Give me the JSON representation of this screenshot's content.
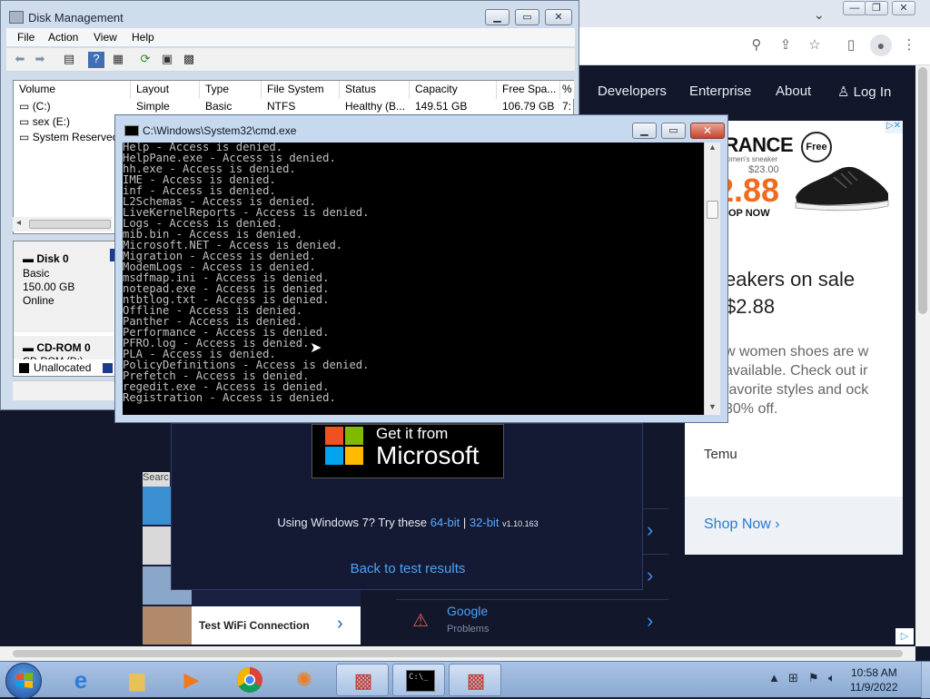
{
  "browser": {
    "nav": [
      "Developers",
      "Enterprise",
      "About",
      "Log In"
    ],
    "ad": {
      "clearance": "ARANCE",
      "sub": "omen's sneaker",
      "old_price": "$23.00",
      "price": "2.88",
      "shop": "HOP NOW",
      "free": "Free",
      "headline": "eakers on sale",
      "price_line": "$2.88",
      "desc": "w women shoes are w available. Check out ir favorite styles and ock 30% off.",
      "brand": "Temu",
      "cta": "Shop Now"
    },
    "promo": {
      "get_it": "Get it from",
      "microsoft": "Microsoft",
      "win7_prefix": "Using Windows 7? Try these",
      "link64": "64-bit",
      "sep": "|",
      "link32": "32-bit",
      "version": "v1.10.163",
      "back": "Back to test results"
    },
    "left_list": {
      "search": "Searc",
      "wifi": "Test WiFi Connection"
    },
    "right_list": {
      "google_title": "Google",
      "google_sub": "Problems"
    }
  },
  "disk_mgmt": {
    "title": "Disk Management",
    "menu": [
      "File",
      "Action",
      "View",
      "Help"
    ],
    "columns": [
      "Volume",
      "Layout",
      "Type",
      "File System",
      "Status",
      "Capacity",
      "Free Spa...",
      "%"
    ],
    "rows": [
      {
        "volume": "(C:)",
        "layout": "Simple",
        "type": "Basic",
        "fs": "NTFS",
        "status": "Healthy (B...",
        "capacity": "149.51 GB",
        "free": "106.79 GB",
        "pct": "7:"
      },
      {
        "volume": "sex (E:)"
      },
      {
        "volume": "System Reserved"
      }
    ],
    "disk0": {
      "name": "Disk 0",
      "type": "Basic",
      "size": "150.00 GB",
      "state": "Online"
    },
    "cdrom": {
      "name": "CD-ROM 0",
      "sub": "CD-ROM (D:)"
    },
    "legend": {
      "unallocated": "Unallocated",
      "p": "P"
    }
  },
  "cmd": {
    "title": "C:\\Windows\\System32\\cmd.exe",
    "lines": [
      "Help - Access is denied.",
      "HelpPane.exe - Access is denied.",
      "hh.exe - Access is denied.",
      "IME - Access is denied.",
      "inf - Access is denied.",
      "L2Schemas - Access is denied.",
      "LiveKernelReports - Access is denied.",
      "Logs - Access is denied.",
      "mib.bin - Access is denied.",
      "Microsoft.NET - Access is denied.",
      "Migration - Access is denied.",
      "ModemLogs - Access is denied.",
      "msdfmap.ini - Access is denied.",
      "notepad.exe - Access is denied.",
      "ntbtlog.txt - Access is denied.",
      "Offline - Access is denied.",
      "Panther - Access is denied.",
      "Performance - Access is denied.",
      "PFRO.log - Access is denied.",
      "PLA - Access is denied.",
      "PolicyDefinitions - Access is denied.",
      "Prefetch - Access is denied.",
      "regedit.exe - Access is denied.",
      "Registration - Access is denied."
    ]
  },
  "taskbar": {
    "time": "10:58 AM",
    "date": "11/9/2022"
  }
}
